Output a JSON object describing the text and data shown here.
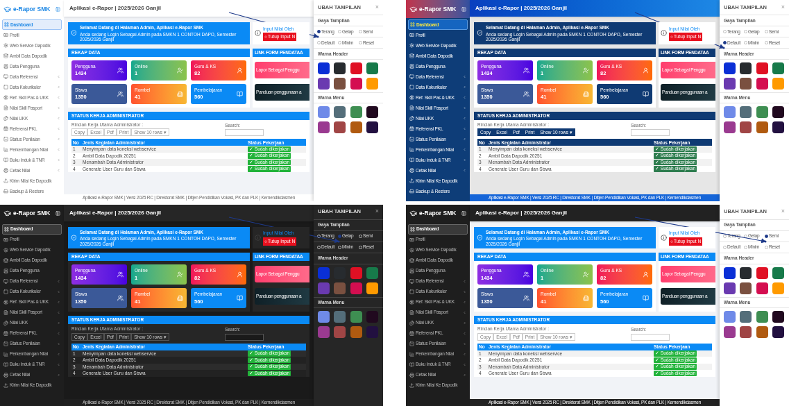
{
  "panels": [
    {
      "kind": "light",
      "brand": "e-Rapor SMK",
      "title": "Aplikasi e-Rapor | 2025/2026 Ganjil",
      "sidebar": [
        {
          "label": "Dashboard",
          "selected": true,
          "expandable": false
        },
        {
          "label": "Profil",
          "selected": false,
          "expandable": false
        },
        {
          "label": "Web Service Dapodik",
          "selected": false,
          "expandable": false
        },
        {
          "label": "Ambil Data Dapodik",
          "selected": false,
          "expandable": false
        },
        {
          "label": "Data Pengguna",
          "selected": false,
          "expandable": false
        },
        {
          "label": "Data Referensi",
          "selected": false,
          "expandable": true
        },
        {
          "label": "Data Kokurikuler",
          "selected": false,
          "expandable": true
        },
        {
          "label": "Ref. Skill Pas & UKK",
          "selected": false,
          "expandable": true
        },
        {
          "label": "Nilai Skill Pasport",
          "selected": false,
          "expandable": true
        },
        {
          "label": "Nilai UKK",
          "selected": false,
          "expandable": true
        },
        {
          "label": "Referensi PKL",
          "selected": false,
          "expandable": true
        },
        {
          "label": "Status Penilaian",
          "selected": false,
          "expandable": true
        },
        {
          "label": "Perkembangan Nilai",
          "selected": false,
          "expandable": true
        },
        {
          "label": "Buku Induk & TNR",
          "selected": false,
          "expandable": true
        },
        {
          "label": "Cetak Nilai",
          "selected": false,
          "expandable": true
        },
        {
          "label": "Kirim Nilai Ke Dapodik",
          "selected": false,
          "expandable": false
        },
        {
          "label": "Backup & Restore",
          "selected": false,
          "expandable": false
        }
      ],
      "welcome": {
        "title": "Selamat Datang di Halaman Admin, Aplikasi e-Rapor SMK",
        "subtitle": "Anda sedang Login Sebagai Admin pada SMKN 1 CONTOH DAPO, Semester 2025/2026 Ganjil"
      },
      "notice": {
        "title": "Input Nilai Oleh",
        "button": "Tutup Input N"
      },
      "rekap": {
        "title": "REKAP DATA",
        "stats": [
          {
            "label": "Pengguna",
            "value": "1434",
            "kind": "purple"
          },
          {
            "label": "Online",
            "value": "1",
            "kind": "green"
          },
          {
            "label": "Guru & KS",
            "value": "82",
            "kind": "red"
          },
          {
            "label": "Siswa",
            "value": "1350",
            "kind": "navy"
          },
          {
            "label": "Rombel",
            "value": "41",
            "kind": "orange"
          },
          {
            "label": "Pembelajaran",
            "value": "560",
            "kind": "primary"
          }
        ]
      },
      "links": {
        "title": "LINK FORM PENDATAA",
        "items": [
          {
            "label": "Lapor Sebagai Penggu",
            "kind": "pink"
          },
          {
            "label": "Panduan penggunaan a",
            "kind": "dark"
          }
        ]
      },
      "status": {
        "title": "STATUS KERJA ADMINISTRATOR",
        "caption": "Rincian Kerja Utama Administrator :",
        "buttons": [
          "Copy",
          "Excel",
          "Pdf",
          "Print",
          "Show 10 rows ▾"
        ],
        "search_label": "Search:",
        "columns": [
          "No",
          "Jenis Kegiatan Administrator",
          "Status Pekerjaan"
        ],
        "rows": [
          {
            "no": "1",
            "activity": "Menyimpan data koneksi webservice",
            "status": "✓ Sudah dikerjakan"
          },
          {
            "no": "2",
            "activity": "Ambil Data Dapodik 20251",
            "status": "✓ Sudah dikerjakan"
          },
          {
            "no": "3",
            "activity": "Menambah Data Administrator",
            "status": "✓ Sudah dikerjakan"
          },
          {
            "no": "4",
            "activity": "Generate User Guru dan Siswa",
            "status": "✓ Sudah dikerjakan"
          }
        ]
      },
      "footer": "Aplikasi e-Rapor SMK | Versi 2025 RC | Direktorat SMK | Ditjen Pendidikan Vokasi, PK dan PLK | Kemendikdasmen",
      "drawer": {
        "title": "UBAH TAMPILAN",
        "close": "×",
        "style_label": "Gaya Tampilan",
        "modes": [
          {
            "label": "Terang",
            "selected": true
          },
          {
            "label": "Gelap",
            "selected": false
          },
          {
            "label": "Semi",
            "selected": false
          }
        ],
        "layouts": [
          {
            "label": "Default",
            "selected": false
          },
          {
            "label": "Minim",
            "selected": false
          },
          {
            "label": "Reset",
            "selected": false
          }
        ],
        "header_label": "Warna Header",
        "header_colors": [
          {
            "color": "#0a2fd6"
          },
          {
            "color": "#272b2f"
          },
          {
            "color": "#e01024"
          },
          {
            "color": "#177a4a"
          },
          {
            "color": "#6a3ab0"
          },
          {
            "color": "#7a5040"
          },
          {
            "color": "#d40e50"
          },
          {
            "color": "#ff9a00"
          }
        ],
        "menu_label": "Warna Menu",
        "menu_colors": [
          {
            "color": "#6f8ae8"
          },
          {
            "color": "#546e7a"
          },
          {
            "color": "#3e8e52"
          },
          {
            "color": "#21091f"
          },
          {
            "color": "#9a3a90"
          },
          {
            "color": "#a04545"
          },
          {
            "color": "#b05a10"
          },
          {
            "color": "#221040"
          }
        ]
      }
    },
    {
      "kind": "blue",
      "brand": "e-Rapor SMK",
      "title": "Aplikasi e-Rapor | 2025/2026 Ganjil",
      "sidebar": [
        {
          "label": "Dashboard",
          "selected": true,
          "expandable": false
        },
        {
          "label": "Profil",
          "selected": false,
          "expandable": false
        },
        {
          "label": "Web Service Dapodik",
          "selected": false,
          "expandable": false
        },
        {
          "label": "Ambil Data Dapodik",
          "selected": false,
          "expandable": false
        },
        {
          "label": "Data Pengguna",
          "selected": false,
          "expandable": false
        },
        {
          "label": "Data Referensi",
          "selected": false,
          "expandable": true
        },
        {
          "label": "Data Kokurikuler",
          "selected": false,
          "expandable": true
        },
        {
          "label": "Ref. Skill Pas & UKK",
          "selected": false,
          "expandable": true
        },
        {
          "label": "Nilai Skill Pasport",
          "selected": false,
          "expandable": true
        },
        {
          "label": "Nilai UKK",
          "selected": false,
          "expandable": true
        },
        {
          "label": "Referensi PKL",
          "selected": false,
          "expandable": true
        },
        {
          "label": "Status Penilaian",
          "selected": false,
          "expandable": true
        },
        {
          "label": "Perkembangan Nilai",
          "selected": false,
          "expandable": true
        },
        {
          "label": "Buku Induk & TNR",
          "selected": false,
          "expandable": true
        },
        {
          "label": "Cetak Nilai",
          "selected": false,
          "expandable": true
        },
        {
          "label": "Kirim Nilai Ke Dapodik",
          "selected": false,
          "expandable": false
        },
        {
          "label": "Backup & Restore",
          "selected": false,
          "expandable": false
        }
      ],
      "welcome": {
        "title": "Selamat Datang di Halaman Admin, Aplikasi e-Rapor SMK",
        "subtitle": "Anda sedang Login Sebagai Admin pada SMKN 1 CONTOH DAPO, Semester 2025/2026 Ganjil"
      },
      "notice": {
        "title": "Input Nilai Oleh",
        "button": "Tutup Input N"
      },
      "rekap": {
        "title": "REKAP DATA",
        "stats": [
          {
            "label": "Pengguna",
            "value": "1434",
            "kind": "purple"
          },
          {
            "label": "Online",
            "value": "1",
            "kind": "green"
          },
          {
            "label": "Guru & KS",
            "value": "82",
            "kind": "red"
          },
          {
            "label": "Siswa",
            "value": "1350",
            "kind": "navy"
          },
          {
            "label": "Rombel",
            "value": "41",
            "kind": "orange"
          },
          {
            "label": "Pembelajaran",
            "value": "560",
            "kind": "primary"
          }
        ]
      },
      "links": {
        "title": "LINK FORM PENDATAA",
        "items": [
          {
            "label": "Lapor Sebagai Penggu",
            "kind": "pink"
          },
          {
            "label": "Panduan penggunaan a",
            "kind": "dark"
          }
        ]
      },
      "status": {
        "title": "STATUS KERJA ADMINISTRATOR",
        "caption": "Rincian Kerja Utama Administrator :",
        "buttons": [
          "Copy",
          "Excel",
          "Pdf",
          "Print",
          "Show 10 rows ▾"
        ],
        "search_label": "Search:",
        "columns": [
          "No",
          "Jenis Kegiatan Administrator",
          "Status Pekerjaan"
        ],
        "rows": [
          {
            "no": "1",
            "activity": "Menyimpan data koneksi webservice",
            "status": "✓ Sudah dikerjakan"
          },
          {
            "no": "2",
            "activity": "Ambil Data Dapodik 20251",
            "status": "✓ Sudah dikerjakan"
          },
          {
            "no": "3",
            "activity": "Menambah Data Administrator",
            "status": "✓ Sudah dikerjakan"
          },
          {
            "no": "4",
            "activity": "Generate User Guru dan Siswa",
            "status": "✓ Sudah dikerjakan"
          }
        ]
      },
      "footer": "Aplikasi e-Rapor SMK | Versi 2025 RC | Direktorat SMK | Ditjen Pendidikan Vokasi, PK dan PLK | Kemendikdasmen",
      "drawer": {
        "title": "UBAH TAMPILAN",
        "close": "×",
        "style_label": "Gaya Tampilan",
        "modes": [
          {
            "label": "Terang",
            "selected": false
          },
          {
            "label": "Gelap",
            "selected": false
          },
          {
            "label": "Semi",
            "selected": false
          }
        ],
        "layouts": [
          {
            "label": "Default",
            "selected": true
          },
          {
            "label": "Minim",
            "selected": false
          },
          {
            "label": "Reset",
            "selected": false
          }
        ],
        "header_label": "Warna Header",
        "header_colors": [
          {
            "color": "#0a2fd6"
          },
          {
            "color": "#272b2f"
          },
          {
            "color": "#e01024"
          },
          {
            "color": "#177a4a"
          },
          {
            "color": "#6a3ab0"
          },
          {
            "color": "#7a5040"
          },
          {
            "color": "#d40e50"
          },
          {
            "color": "#ff9a00"
          }
        ],
        "menu_label": "Warna Menu",
        "menu_colors": [
          {
            "color": "#6f8ae8"
          },
          {
            "color": "#546e7a"
          },
          {
            "color": "#3e8e52"
          },
          {
            "color": "#21091f"
          },
          {
            "color": "#9a3a90"
          },
          {
            "color": "#a04545"
          },
          {
            "color": "#b05a10"
          },
          {
            "color": "#221040"
          }
        ]
      }
    },
    {
      "kind": "dark",
      "brand": "e-Rapor SMK",
      "title": "Aplikasi e-Rapor | 2025/2026 Ganjil",
      "sidebar": [
        {
          "label": "Dashboard",
          "selected": true,
          "expandable": false
        },
        {
          "label": "Profil",
          "selected": false,
          "expandable": false
        },
        {
          "label": "Web Service Dapodik",
          "selected": false,
          "expandable": false
        },
        {
          "label": "Ambil Data Dapodik",
          "selected": false,
          "expandable": false
        },
        {
          "label": "Data Pengguna",
          "selected": false,
          "expandable": false
        },
        {
          "label": "Data Referensi",
          "selected": false,
          "expandable": true
        },
        {
          "label": "Data Kokurikuler",
          "selected": false,
          "expandable": true
        },
        {
          "label": "Ref. Skill Pas & UKK",
          "selected": false,
          "expandable": true
        },
        {
          "label": "Nilai Skill Pasport",
          "selected": false,
          "expandable": true
        },
        {
          "label": "Nilai UKK",
          "selected": false,
          "expandable": true
        },
        {
          "label": "Referensi PKL",
          "selected": false,
          "expandable": true
        },
        {
          "label": "Status Penilaian",
          "selected": false,
          "expandable": true
        },
        {
          "label": "Perkembangan Nilai",
          "selected": false,
          "expandable": true
        },
        {
          "label": "Buku Induk & TNR",
          "selected": false,
          "expandable": true
        },
        {
          "label": "Cetak Nilai",
          "selected": false,
          "expandable": true
        },
        {
          "label": "Kirim Nilai Ke Dapodik",
          "selected": false,
          "expandable": false
        }
      ],
      "welcome": {
        "title": "Selamat Datang di Halaman Admin, Aplikasi e-Rapor SMK",
        "subtitle": "Anda sedang Login Sebagai Admin pada SMKN 1 CONTOH DAPO, Semester 2025/2026 Ganjil"
      },
      "notice": {
        "title": "Input Nilai Oleh",
        "button": "Tutup Input N"
      },
      "rekap": {
        "title": "REKAP DATA",
        "stats": [
          {
            "label": "Pengguna",
            "value": "1434",
            "kind": "purple"
          },
          {
            "label": "Online",
            "value": "1",
            "kind": "green"
          },
          {
            "label": "Guru & KS",
            "value": "82",
            "kind": "red"
          },
          {
            "label": "Siswa",
            "value": "1350",
            "kind": "navy"
          },
          {
            "label": "Rombel",
            "value": "41",
            "kind": "orange"
          },
          {
            "label": "Pembelajaran",
            "value": "560",
            "kind": "primary"
          }
        ]
      },
      "links": {
        "title": "LINK FORM PENDATAA",
        "items": [
          {
            "label": "Lapor Sebagai Penggu",
            "kind": "pink"
          },
          {
            "label": "Panduan penggunaan a",
            "kind": "dark"
          }
        ]
      },
      "status": {
        "title": "STATUS KERJA ADMINISTRATOR",
        "caption": "Rincian Kerja Utama Administrator :",
        "buttons": [
          "Copy",
          "Excel",
          "Pdf",
          "Print",
          "Show 10 rows ▾"
        ],
        "search_label": "Search:",
        "columns": [
          "No",
          "Jenis Kegiatan Administrator",
          "Status Pekerjaan"
        ],
        "rows": [
          {
            "no": "1",
            "activity": "Menyimpan data koneksi webservice",
            "status": "✓ Sudah dikerjakan"
          },
          {
            "no": "2",
            "activity": "Ambil Data Dapodik 20251",
            "status": "✓ Sudah dikerjakan"
          },
          {
            "no": "3",
            "activity": "Menambah Data Administrator",
            "status": "✓ Sudah dikerjakan"
          },
          {
            "no": "4",
            "activity": "Generate User Guru dan Siswa",
            "status": "✓ Sudah dikerjakan"
          }
        ]
      },
      "footer": "Aplikasi e-Rapor SMK | Versi 2025 RC | Direktorat SMK | Ditjen Pendidikan Vokasi, PK dan PLK | Kemendikdasmen",
      "drawer": {
        "title": "UBAH TAMPILAN",
        "close": "×",
        "style_label": "Gaya Tampilan",
        "modes": [
          {
            "label": "Terang",
            "selected": false
          },
          {
            "label": "Gelap",
            "selected": true
          },
          {
            "label": "Semi",
            "selected": false
          }
        ],
        "layouts": [
          {
            "label": "Default",
            "selected": false
          },
          {
            "label": "Minim",
            "selected": false
          },
          {
            "label": "Reset",
            "selected": false
          }
        ],
        "header_label": "Warna Header",
        "header_colors": [
          {
            "color": "#0a2fd6"
          },
          {
            "color": "#272b2f"
          },
          {
            "color": "#e01024"
          },
          {
            "color": "#177a4a"
          },
          {
            "color": "#6a3ab0"
          },
          {
            "color": "#7a5040"
          },
          {
            "color": "#d40e50"
          },
          {
            "color": "#ff9a00"
          }
        ],
        "menu_label": "Warna Menu",
        "menu_colors": [
          {
            "color": "#6f8ae8"
          },
          {
            "color": "#546e7a"
          },
          {
            "color": "#3e8e52"
          },
          {
            "color": "#21091f"
          },
          {
            "color": "#9a3a90"
          },
          {
            "color": "#a04545"
          },
          {
            "color": "#b05a10"
          },
          {
            "color": "#221040"
          }
        ]
      }
    },
    {
      "kind": "semi",
      "brand": "e-Rapor SMK",
      "title": "Aplikasi e-Rapor | 2025/2026 Ganjil",
      "sidebar": [
        {
          "label": "Dashboard",
          "selected": true,
          "expandable": false
        },
        {
          "label": "Profil",
          "selected": false,
          "expandable": false
        },
        {
          "label": "Web Service Dapodik",
          "selected": false,
          "expandable": false
        },
        {
          "label": "Ambil Data Dapodik",
          "selected": false,
          "expandable": false
        },
        {
          "label": "Data Pengguna",
          "selected": false,
          "expandable": false
        },
        {
          "label": "Data Referensi",
          "selected": false,
          "expandable": true
        },
        {
          "label": "Data Kokurikuler",
          "selected": false,
          "expandable": true
        },
        {
          "label": "Ref. Skill Pas & UKK",
          "selected": false,
          "expandable": true
        },
        {
          "label": "Nilai Skill Pasport",
          "selected": false,
          "expandable": true
        },
        {
          "label": "Nilai UKK",
          "selected": false,
          "expandable": true
        },
        {
          "label": "Referensi PKL",
          "selected": false,
          "expandable": true
        },
        {
          "label": "Status Penilaian",
          "selected": false,
          "expandable": true
        },
        {
          "label": "Perkembangan Nilai",
          "selected": false,
          "expandable": true
        },
        {
          "label": "Buku Induk & TNR",
          "selected": false,
          "expandable": true
        },
        {
          "label": "Cetak Nilai",
          "selected": false,
          "expandable": true
        },
        {
          "label": "Kirim Nilai Ke Dapodik",
          "selected": false,
          "expandable": false
        }
      ],
      "welcome": {
        "title": "Selamat Datang di Halaman Admin, Aplikasi e-Rapor SMK",
        "subtitle": "Anda sedang Login Sebagai Admin pada SMKN 1 CONTOH DAPO, Semester 2025/2026 Ganjil"
      },
      "notice": {
        "title": "Input Nilai Oleh",
        "button": "Tutup Input N"
      },
      "rekap": {
        "title": "REKAP DATA",
        "stats": [
          {
            "label": "Pengguna",
            "value": "1434",
            "kind": "purple"
          },
          {
            "label": "Online",
            "value": "1",
            "kind": "green"
          },
          {
            "label": "Guru & KS",
            "value": "82",
            "kind": "red"
          },
          {
            "label": "Siswa",
            "value": "1350",
            "kind": "navy"
          },
          {
            "label": "Rombel",
            "value": "41",
            "kind": "orange"
          },
          {
            "label": "Pembelajaran",
            "value": "560",
            "kind": "primary"
          }
        ]
      },
      "links": {
        "title": "LINK FORM PENDATAA",
        "items": [
          {
            "label": "Lapor Sebagai Penggu",
            "kind": "pink"
          },
          {
            "label": "Panduan penggunaan a",
            "kind": "dark"
          }
        ]
      },
      "status": {
        "title": "STATUS KERJA ADMINISTRATOR",
        "caption": "Rincian Kerja Utama Administrator :",
        "buttons": [
          "Copy",
          "Excel",
          "Pdf",
          "Print",
          "Show 10 rows ▾"
        ],
        "search_label": "Search:",
        "columns": [
          "No",
          "Jenis Kegiatan Administrator",
          "Status Pekerjaan"
        ],
        "rows": [
          {
            "no": "1",
            "activity": "Menyimpan data koneksi webservice",
            "status": "✓ Sudah dikerjakan"
          },
          {
            "no": "2",
            "activity": "Ambil Data Dapodik 20251",
            "status": "✓ Sudah dikerjakan"
          },
          {
            "no": "3",
            "activity": "Menambah Data Administrator",
            "status": "✓ Sudah dikerjakan"
          },
          {
            "no": "4",
            "activity": "Generate User Guru dan Siswa",
            "status": "✓ Sudah dikerjakan"
          }
        ]
      },
      "footer": "Aplikasi e-Rapor SMK | Versi 2025 RC | Direktorat SMK | Ditjen Pendidikan Vokasi, PK dan PLK | Kemendikdasmen",
      "drawer": {
        "title": "UBAH TAMPILAN",
        "close": "×",
        "style_label": "Gaya Tampilan",
        "modes": [
          {
            "label": "Terang",
            "selected": false
          },
          {
            "label": "Gelap",
            "selected": false
          },
          {
            "label": "Semi",
            "selected": true
          }
        ],
        "layouts": [
          {
            "label": "Default",
            "selected": false
          },
          {
            "label": "Minim",
            "selected": false
          },
          {
            "label": "Reset",
            "selected": false
          }
        ],
        "header_label": "Warna Header",
        "header_colors": [
          {
            "color": "#0a2fd6"
          },
          {
            "color": "#272b2f"
          },
          {
            "color": "#e01024"
          },
          {
            "color": "#177a4a"
          },
          {
            "color": "#6a3ab0"
          },
          {
            "color": "#7a5040"
          },
          {
            "color": "#d40e50"
          },
          {
            "color": "#ff9a00"
          }
        ],
        "menu_label": "Warna Menu",
        "menu_colors": [
          {
            "color": "#6f8ae8"
          },
          {
            "color": "#546e7a"
          },
          {
            "color": "#3e8e52"
          },
          {
            "color": "#21091f"
          },
          {
            "color": "#9a3a90"
          },
          {
            "color": "#a04545"
          },
          {
            "color": "#b05a10"
          },
          {
            "color": "#221040"
          }
        ]
      }
    }
  ]
}
